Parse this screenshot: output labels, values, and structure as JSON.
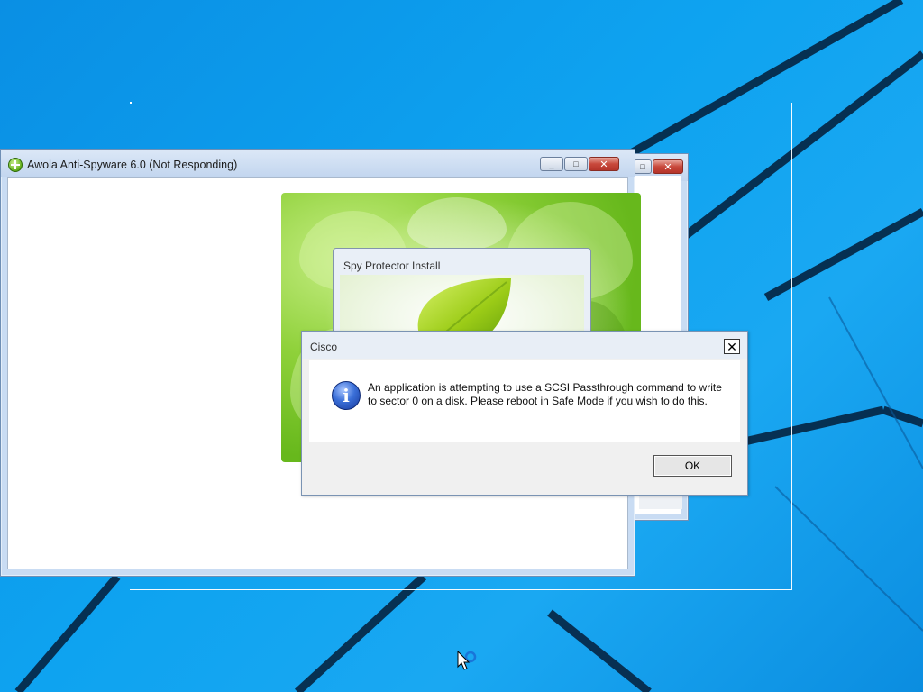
{
  "desktop": {
    "background_color": "#0b94e8"
  },
  "awola_window": {
    "title": "Awola Anti-Spyware 6.0 (Not Responding)"
  },
  "spy_window": {
    "title": "Spy Protector Install"
  },
  "cisco_dialog": {
    "title": "Cisco",
    "message": "An application is attempting to use a SCSI Passthrough command to write to sector 0 on a disk. Please reboot in Safe Mode if you wish to do this.",
    "ok_label": "OK",
    "close_glyph": "✕"
  },
  "icons": {
    "info": "i",
    "minimize": "_",
    "maximize": "□",
    "close": "✕"
  }
}
